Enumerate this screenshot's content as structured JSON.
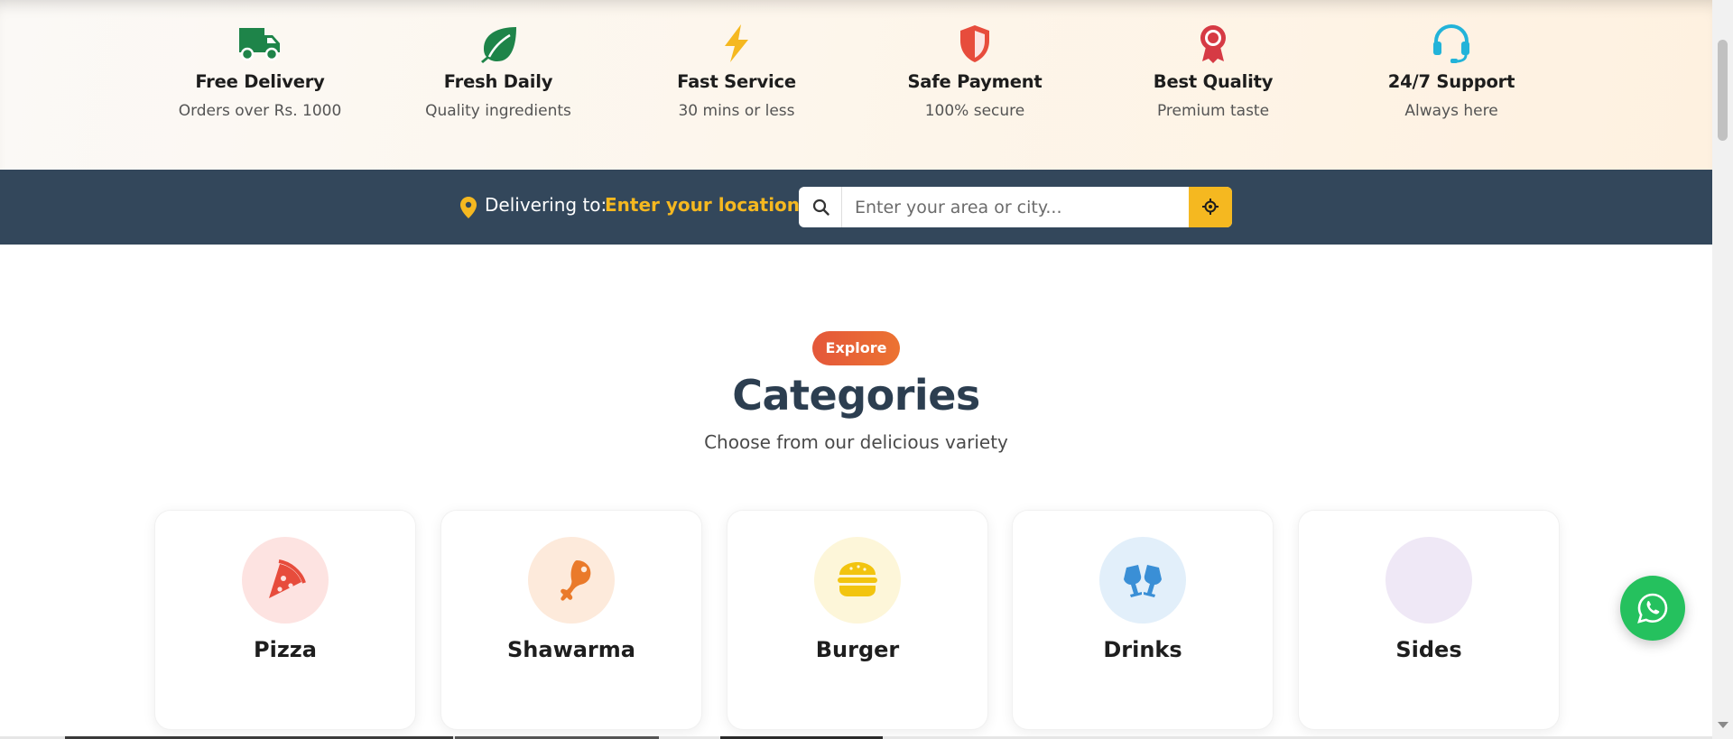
{
  "features": [
    {
      "title": "Free Delivery",
      "subtitle": "Orders over Rs. 1000",
      "icon": "truck-icon",
      "color": "#1e8449"
    },
    {
      "title": "Fresh Daily",
      "subtitle": "Quality ingredients",
      "icon": "leaf-icon",
      "color": "#1e8449"
    },
    {
      "title": "Fast Service",
      "subtitle": "30 mins or less",
      "icon": "lightning-icon",
      "color": "#f5b820"
    },
    {
      "title": "Safe Payment",
      "subtitle": "100% secure",
      "icon": "shield-icon",
      "color": "#e74c3c"
    },
    {
      "title": "Best Quality",
      "subtitle": "Premium taste",
      "icon": "award-icon",
      "color": "#d63a44"
    },
    {
      "title": "24/7 Support",
      "subtitle": "Always here",
      "icon": "headset-icon",
      "color": "#22b3d9"
    }
  ],
  "location": {
    "label": "Delivering to:",
    "value": "Enter your location",
    "search_placeholder": "Enter your area or city...",
    "search_value": "",
    "pin_icon": "location-pin-icon",
    "search_icon": "search-icon",
    "locate_icon": "crosshair-icon",
    "accent_color": "#f5b820",
    "bar_color": "#33475b"
  },
  "categories": {
    "badge": "Explore",
    "title": "Categories",
    "subtitle": "Choose from our delicious variety",
    "items": [
      {
        "name": "Pizza",
        "icon": "pizza-icon",
        "circle_color": "#fde3e1"
      },
      {
        "name": "Shawarma",
        "icon": "drumstick-icon",
        "circle_color": "#fdeadb"
      },
      {
        "name": "Burger",
        "icon": "burger-icon",
        "circle_color": "#fdf6d9"
      },
      {
        "name": "Drinks",
        "icon": "glasses-cheers-icon",
        "circle_color": "#e2effa"
      },
      {
        "name": "Sides",
        "icon": "",
        "circle_color": "#efe8f6"
      }
    ]
  },
  "whatsapp": {
    "icon": "whatsapp-icon",
    "color": "#25c15e"
  }
}
